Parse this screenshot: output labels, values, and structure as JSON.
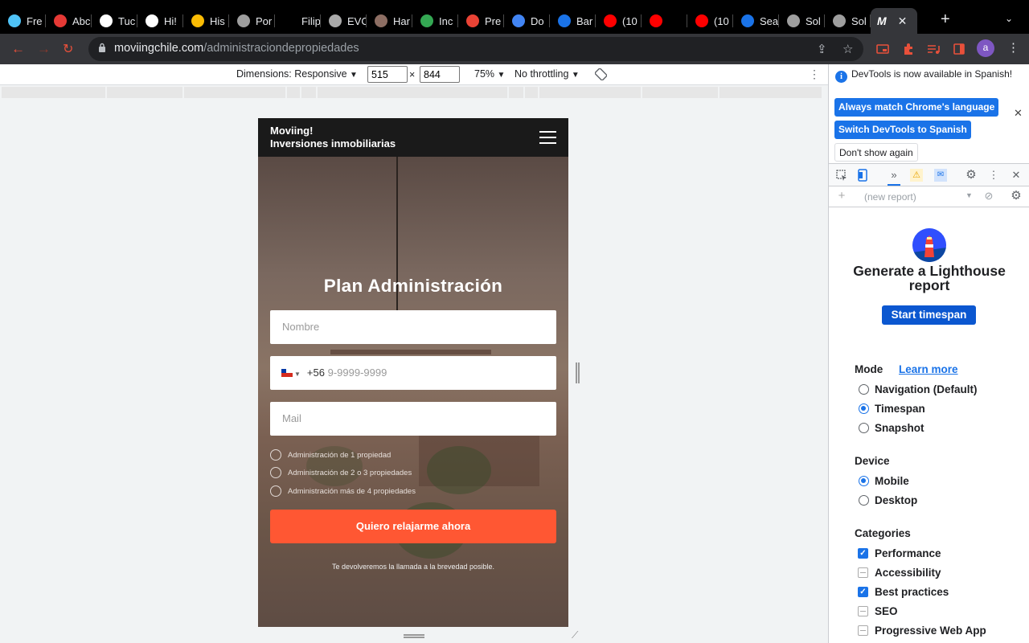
{
  "browser": {
    "tabs": [
      {
        "label": "Fre",
        "icon": "globe-icon",
        "color": "#4fc3f7"
      },
      {
        "label": "Abc",
        "icon": "dots-icon",
        "color": "#e53935"
      },
      {
        "label": "Tuc",
        "icon": "th-icon",
        "color": "#ffffff"
      },
      {
        "label": "Hi!",
        "icon": "h-icon",
        "color": "#ffffff"
      },
      {
        "label": "His",
        "icon": "colors-icon",
        "color": "#fbbc04"
      },
      {
        "label": "Por",
        "icon": "circle-icon",
        "color": "#9e9e9e"
      },
      {
        "label": "Filip",
        "icon": "blank-icon",
        "color": "#000000"
      },
      {
        "label": "EVO",
        "icon": "flsh-icon",
        "color": "#aaaaaa"
      },
      {
        "label": "Har",
        "icon": "portrait-icon",
        "color": "#8d6e63"
      },
      {
        "label": "Inc",
        "icon": "grid-icon",
        "color": "#34a853"
      },
      {
        "label": "Pre",
        "icon": "slides-icon",
        "color": "#ea4335"
      },
      {
        "label": "Do",
        "icon": "docs-icon",
        "color": "#4285f4"
      },
      {
        "label": "Bar",
        "icon": "flag-icon",
        "color": "#1a73e8"
      },
      {
        "label": "(10",
        "icon": "youtube-icon",
        "color": "#ff0000"
      },
      {
        "label": "",
        "icon": "youtube-muted-icon",
        "color": "#ff0000"
      },
      {
        "label": "(10",
        "icon": "youtube-icon",
        "color": "#ff0000"
      },
      {
        "label": "Sea",
        "icon": "flag-icon",
        "color": "#1a73e8"
      },
      {
        "label": "Sol",
        "icon": "globe-gray-icon",
        "color": "#9e9e9e"
      },
      {
        "label": "Sol",
        "icon": "globe-gray-icon",
        "color": "#9e9e9e"
      }
    ],
    "active_tab_icon_letter": "M",
    "new_tab": "+",
    "url_host": "moviingchile.com",
    "url_path": "/administraciondepropiedades",
    "avatar_letter": "a"
  },
  "device_toolbar": {
    "dimensions_label": "Dimensions: Responsive",
    "width": "515",
    "height": "844",
    "times": "×",
    "zoom": "75%",
    "throttling": "No throttling"
  },
  "page": {
    "brand_line1": "Moviing!",
    "brand_line2": "Inversiones inmobiliarias",
    "title": "Plan Administración",
    "name_placeholder": "Nombre",
    "phone_code": "+56",
    "phone_placeholder": "9-9999-9999",
    "mail_placeholder": "Mail",
    "options": [
      "Administración de 1 propiedad",
      "Administración de 2 o 3 propiedades",
      "Administración más de 4 propiedades"
    ],
    "cta_label": "Quiero relajarme ahora",
    "callback_note": "Te devolveremos la llamada a la brevedad posible.",
    "cta_color": "#ff5733"
  },
  "devtools": {
    "info_text": "DevTools is now available in Spanish!",
    "btn_match": "Always match Chrome's language",
    "btn_switch": "Switch DevTools to Spanish",
    "btn_dont_show": "Don't show again",
    "report_select": "(new report)",
    "lighthouse_title": "Generate a Lighthouse report",
    "start_button": "Start timespan",
    "mode_label": "Mode",
    "learn_more": "Learn more",
    "modes": [
      "Navigation (Default)",
      "Timespan",
      "Snapshot"
    ],
    "selected_mode": "Timespan",
    "device_label": "Device",
    "devices": [
      "Mobile",
      "Desktop"
    ],
    "selected_device": "Mobile",
    "categories_label": "Categories",
    "categories": [
      {
        "label": "Performance",
        "checked": true
      },
      {
        "label": "Accessibility",
        "checked": false
      },
      {
        "label": "Best practices",
        "checked": true
      },
      {
        "label": "SEO",
        "checked": false
      },
      {
        "label": "Progressive Web App",
        "checked": false
      }
    ]
  }
}
